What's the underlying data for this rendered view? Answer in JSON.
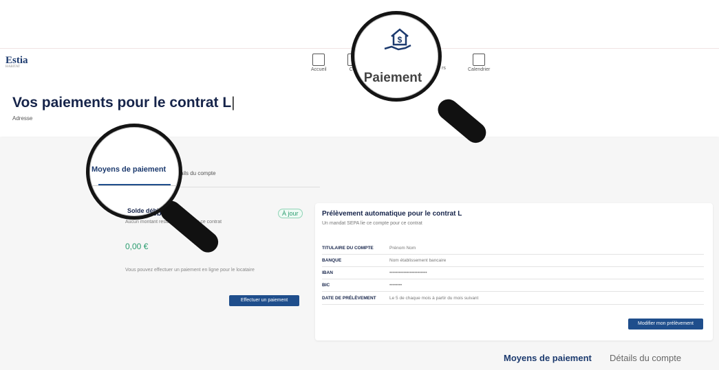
{
  "logo": {
    "name": "Estia",
    "tagline": "HABITAT"
  },
  "nav": {
    "items": [
      {
        "label": "Accueil",
        "icon": "home-icon"
      },
      {
        "label": "Con",
        "icon": "contract-icon"
      },
      {
        "label": "rs",
        "icon": "documents-icon"
      },
      {
        "label": "Calendrier",
        "icon": "calendar-icon"
      }
    ]
  },
  "header": {
    "title": "Vos paiements pour le contrat L",
    "subtitle": "Adresse"
  },
  "tabs": {
    "active": "Moyens de paiement",
    "other_partial": "ails du compte"
  },
  "solde": {
    "title": "Solde débiteur",
    "badge": "À jour",
    "description": "Aucun montant restant à payer sur ce contrat",
    "amount": "0,00 €",
    "info": "Vous pouvez effectuer un paiement en ligne pour le locataire",
    "button": "Effectuer un paiement"
  },
  "prelevement": {
    "title": "Prélèvement automatique pour le contrat L",
    "subtitle": "Un mandat SEPA lie ce compte pour ce contrat",
    "rows": [
      {
        "key": "TITULAIRE DU COMPTE",
        "value": "Prénom Nom"
      },
      {
        "key": "BANQUE",
        "value": "Nom établissement bancaire"
      },
      {
        "key": "IBAN",
        "value": "••••••••••••••••••••••••"
      },
      {
        "key": "BIC",
        "value": "••••••••"
      },
      {
        "key": "DATE DE PRÉLÈVEMENT",
        "value": "Le 5 de chaque mois à partir du mois suivant"
      }
    ],
    "button": "Modifier mon prélèvement"
  },
  "magnifier": {
    "paiement_label": "Paiement",
    "paiement_icon": "house-hand-payment-icon",
    "tab_label": "Moyens de paiement"
  },
  "bottom_tabs": [
    "Moyens de paiement",
    "Détails du compte"
  ],
  "colors": {
    "accent": "#1f4e8c",
    "success": "#2a9c6f",
    "title": "#16244a"
  }
}
